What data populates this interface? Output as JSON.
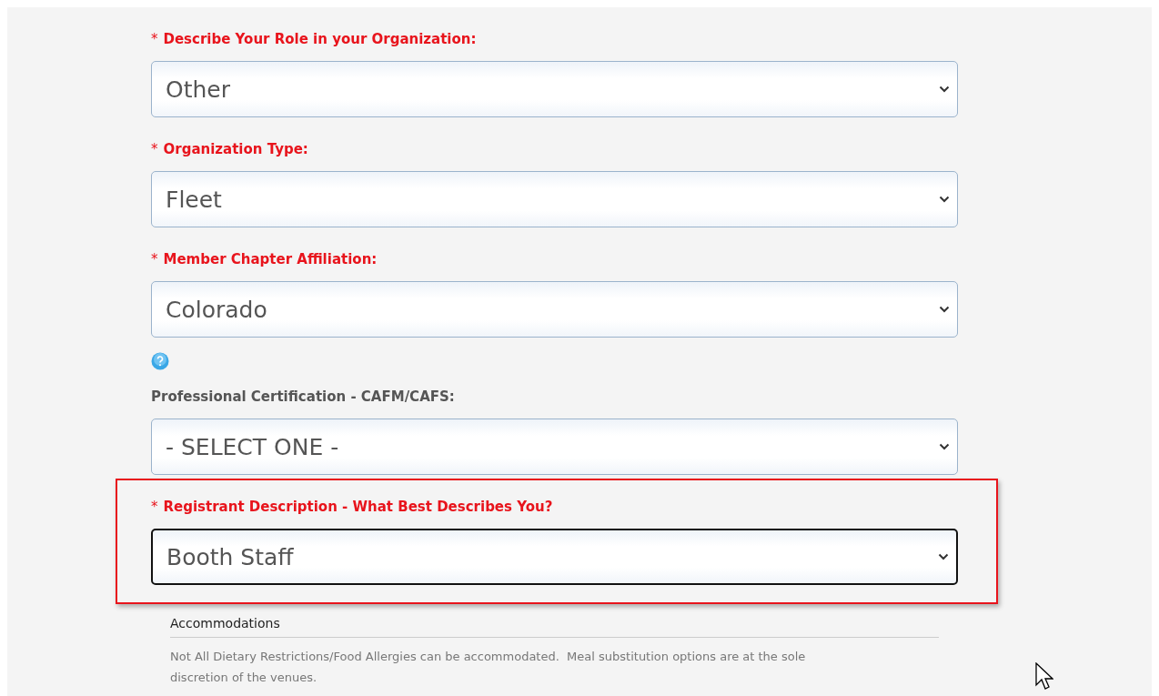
{
  "fields": [
    {
      "kind": "select",
      "required": true,
      "marker": "*",
      "label": "Describe Your Role in your Organization:",
      "value": "Other",
      "focused": false,
      "highlighted": false
    },
    {
      "kind": "select",
      "required": true,
      "marker": "*",
      "label": "Organization Type:",
      "value": "Fleet",
      "focused": false,
      "highlighted": false
    },
    {
      "kind": "select",
      "required": true,
      "marker": "*",
      "label": "Member Chapter Affiliation:",
      "value": "Colorado",
      "focused": false,
      "highlighted": false,
      "help": true
    },
    {
      "kind": "select",
      "required": false,
      "label": "Professional Certification - CAFM/CAFS:",
      "value": "- SELECT ONE -",
      "focused": false,
      "highlighted": false
    },
    {
      "kind": "select",
      "required": true,
      "marker": "*",
      "label": "Registrant Description - What Best Describes You?",
      "value": "Booth Staff",
      "focused": true,
      "highlighted": true
    }
  ],
  "accommodations": {
    "title": "Accommodations",
    "note": "Not All Dietary Restrictions/Food Allergies can be accommodated.  Meal substitution options are at the sole discretion of the venues."
  }
}
